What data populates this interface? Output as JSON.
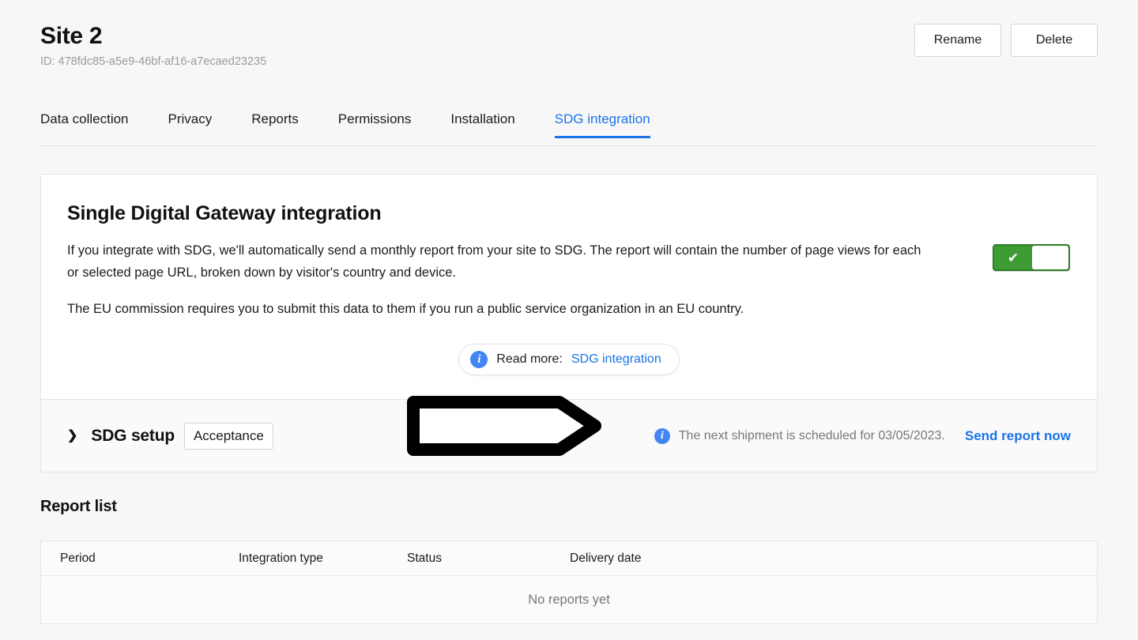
{
  "header": {
    "title": "Site 2",
    "site_id": "ID: 478fdc85-a5e9-46bf-af16-a7ecaed23235",
    "rename_label": "Rename",
    "delete_label": "Delete"
  },
  "tabs": [
    {
      "label": "Data collection",
      "active": false
    },
    {
      "label": "Privacy",
      "active": false
    },
    {
      "label": "Reports",
      "active": false
    },
    {
      "label": "Permissions",
      "active": false
    },
    {
      "label": "Installation",
      "active": false
    },
    {
      "label": "SDG integration",
      "active": true
    }
  ],
  "card": {
    "title": "Single Digital Gateway integration",
    "paragraph1": "If you integrate with SDG, we'll automatically send a monthly report from your site to SDG. The report will contain the number of page views for each or selected page URL, broken down by visitor's country and device.",
    "paragraph2": "The EU commission requires you to submit this data to them if you run a public service organization in an EU country.",
    "toggle": {
      "state": "on",
      "check_glyph": "✔",
      "on_color": "#3f9c35"
    },
    "read_more": {
      "info_glyph": "i",
      "label": "Read more:",
      "link_label": "SDG integration",
      "link_color": "#1a73e8"
    }
  },
  "card_footer": {
    "chevron_glyph": "❯",
    "title": "SDG setup",
    "status_badge": "Acceptance",
    "info_glyph": "i",
    "shipment_text": "The next shipment is scheduled for 03/05/2023.",
    "send_report_label": "Send report now"
  },
  "report_list": {
    "heading": "Report list",
    "columns": [
      "Period",
      "Integration type",
      "Status",
      "Delivery date"
    ],
    "rows": [],
    "empty_text": "No reports yet"
  },
  "annotation": {
    "shape": "right-arrow-outline",
    "stroke_color": "#000000",
    "fill_color": "#ffffff"
  }
}
